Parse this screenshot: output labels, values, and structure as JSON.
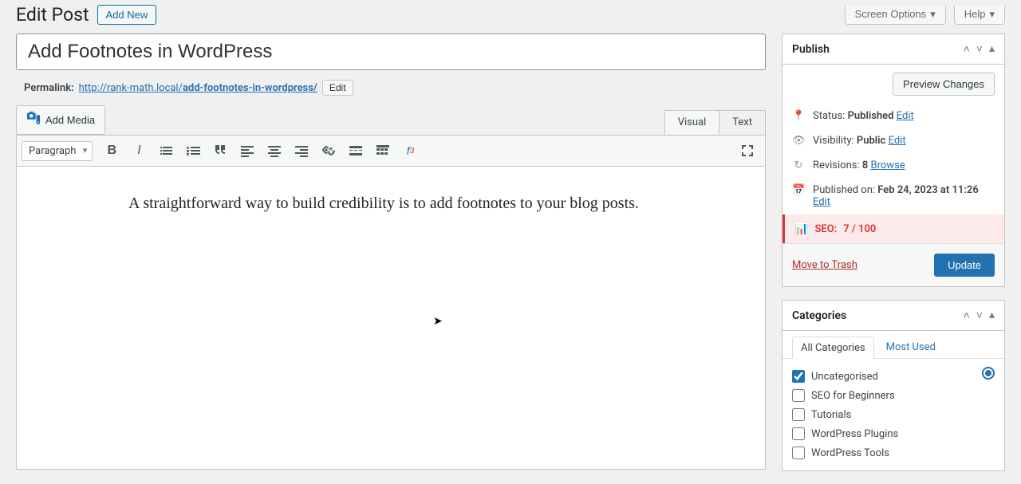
{
  "header": {
    "page_title": "Edit Post",
    "add_new": "Add New",
    "screen_options": "Screen Options",
    "help": "Help"
  },
  "post": {
    "title": "Add Footnotes in WordPress",
    "permalink_label": "Permalink:",
    "permalink_base": "http://rank-math.local/",
    "permalink_slug": "add-footnotes-in-wordpress/",
    "edit_slug": "Edit",
    "body": "A straightforward way to build credibility is to add footnotes to your blog posts."
  },
  "editor": {
    "add_media": "Add Media",
    "tab_visual": "Visual",
    "tab_text": "Text",
    "format": "Paragraph"
  },
  "publish": {
    "title": "Publish",
    "preview": "Preview Changes",
    "status_label": "Status:",
    "status_value": "Published",
    "visibility_label": "Visibility:",
    "visibility_value": "Public",
    "revisions_label": "Revisions:",
    "revisions_value": "8",
    "revisions_action": "Browse",
    "published_label": "Published on:",
    "published_value": "Feb 24, 2023 at 11:26",
    "edit": "Edit",
    "seo_label": "SEO:",
    "seo_score": "7 / 100",
    "trash": "Move to Trash",
    "update": "Update"
  },
  "categories": {
    "title": "Categories",
    "tab_all": "All Categories",
    "tab_most": "Most Used",
    "items": [
      {
        "label": "Uncategorised",
        "checked": true
      },
      {
        "label": "SEO for Beginners",
        "checked": false
      },
      {
        "label": "Tutorials",
        "checked": false
      },
      {
        "label": "WordPress Plugins",
        "checked": false
      },
      {
        "label": "WordPress Tools",
        "checked": false
      }
    ]
  }
}
